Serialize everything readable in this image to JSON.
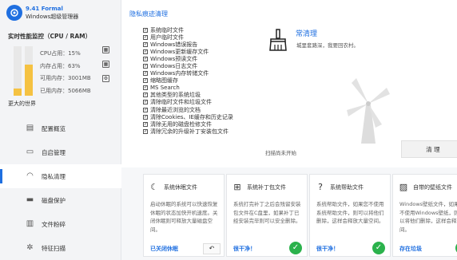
{
  "app": {
    "version": "9.41 Formal",
    "name": "Windows超级管理器"
  },
  "monitor": {
    "title": "实时性能监控（CPU / RAM）",
    "cpu_label": "CPU占用：15%",
    "cpu_percent": 15,
    "mem_label": "内存占用：63%",
    "mem_percent": 63,
    "free_mem": "可用内存：3001MB",
    "used_mem": "已用内存：5066MB",
    "cpu_color": "#f5c242",
    "mem_color": "#f5c242"
  },
  "world_text": "更大的世界",
  "nav": [
    {
      "label": "配置概览",
      "icon": "dashboard-icon"
    },
    {
      "label": "自启管理",
      "icon": "startup-icon"
    },
    {
      "label": "隐私清理",
      "icon": "privacy-icon"
    },
    {
      "label": "磁盘保护",
      "icon": "disk-icon"
    },
    {
      "label": "文件粉碎",
      "icon": "shredder-icon"
    },
    {
      "label": "特征扫描",
      "icon": "scan-icon"
    }
  ],
  "privacy": {
    "section_title": "隐私痕迹清理",
    "items": [
      "系统临时文件",
      "用户临时文件",
      "Windows错误报告",
      "Windows更新缓存文件",
      "Windows预读文件",
      "Windows日志文件",
      "Windows内存转储文件",
      "缩略图缓存",
      "MS Search",
      "其他类型的系统垃圾",
      "清除临时文件和垃圾文件",
      "清除最近浏览的文档",
      "清除Cookies、IE缓存和历史记录",
      "清除无用的磁盘检修文件",
      "清除冗余的升级补丁安装包文件"
    ],
    "clean_title": "常清理",
    "clean_sub": "城里套路深，我要回农村。",
    "scan_status": "扫描尚未开始",
    "clean_button": "清 理",
    "accent": "#1f6fe0"
  },
  "cards": [
    {
      "title": "系统休眠文件",
      "icon": "hibernate-icon",
      "desc": "启动休眠的系统可以快速恢复休眠的状态加快开机速度。关闭休眠则可释放大量磁盘空间。",
      "footer": "已关闭休眠",
      "action": "↶"
    },
    {
      "title": "系统补丁包文件",
      "icon": "patch-icon",
      "desc": "系统打完补丁之后会残留安装包文件在C盘里，如果补丁已经安装完毕则可以安全删除。",
      "footer": "很干净！",
      "action": "✓"
    },
    {
      "title": "系统帮助文件",
      "icon": "help-icon",
      "desc": "系统帮助文件，如果您不使用系统帮助文件，则可以将他们删除，这样会释放大量空间。",
      "footer": "很干净！",
      "action": "✓"
    },
    {
      "title": "自带的壁纸文件",
      "icon": "wallpaper-icon",
      "desc": "Windows壁纸文件，如果您不使用Windows壁纸，则可以将他们删除，这样会释放空间。",
      "footer": "存在垃圾",
      "action": "✓"
    }
  ]
}
